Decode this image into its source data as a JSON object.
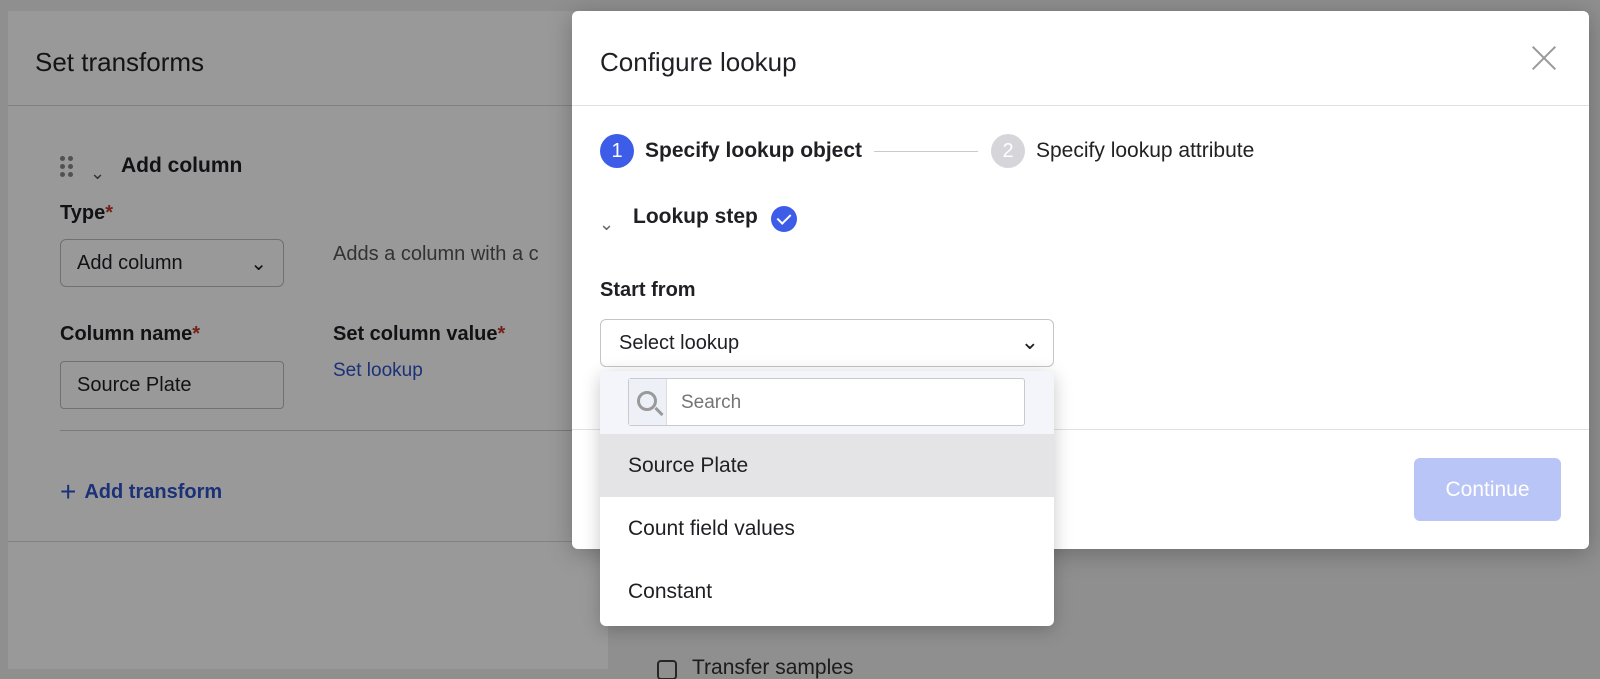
{
  "background": {
    "checkbox_label": "Transfer samples"
  },
  "transforms_panel": {
    "title": "Set transforms",
    "section_title": "Add column",
    "type_label": "Type",
    "type_value": "Add column",
    "type_description": "Adds a column with a c",
    "column_name_label": "Column name",
    "column_name_value": "Source Plate",
    "set_value_label": "Set column value",
    "set_lookup_link": "Set lookup",
    "add_transform": "Add transform",
    "required_mark": "*"
  },
  "modal": {
    "title": "Configure lookup",
    "steps": [
      {
        "number": "1",
        "label": "Specify lookup object"
      },
      {
        "number": "2",
        "label": "Specify lookup attribute"
      }
    ],
    "lookup_step_label": "Lookup step",
    "start_from_label": "Start from",
    "start_from_value": "Select lookup",
    "continue_label": "Continue"
  },
  "dropdown": {
    "search_placeholder": "Search",
    "options": [
      "Source Plate",
      "Count field values",
      "Constant"
    ],
    "selected_index": 0
  },
  "colors": {
    "accent": "#3d5de8",
    "link": "#2e52c9",
    "disabled_button": "#b9c4f7"
  }
}
